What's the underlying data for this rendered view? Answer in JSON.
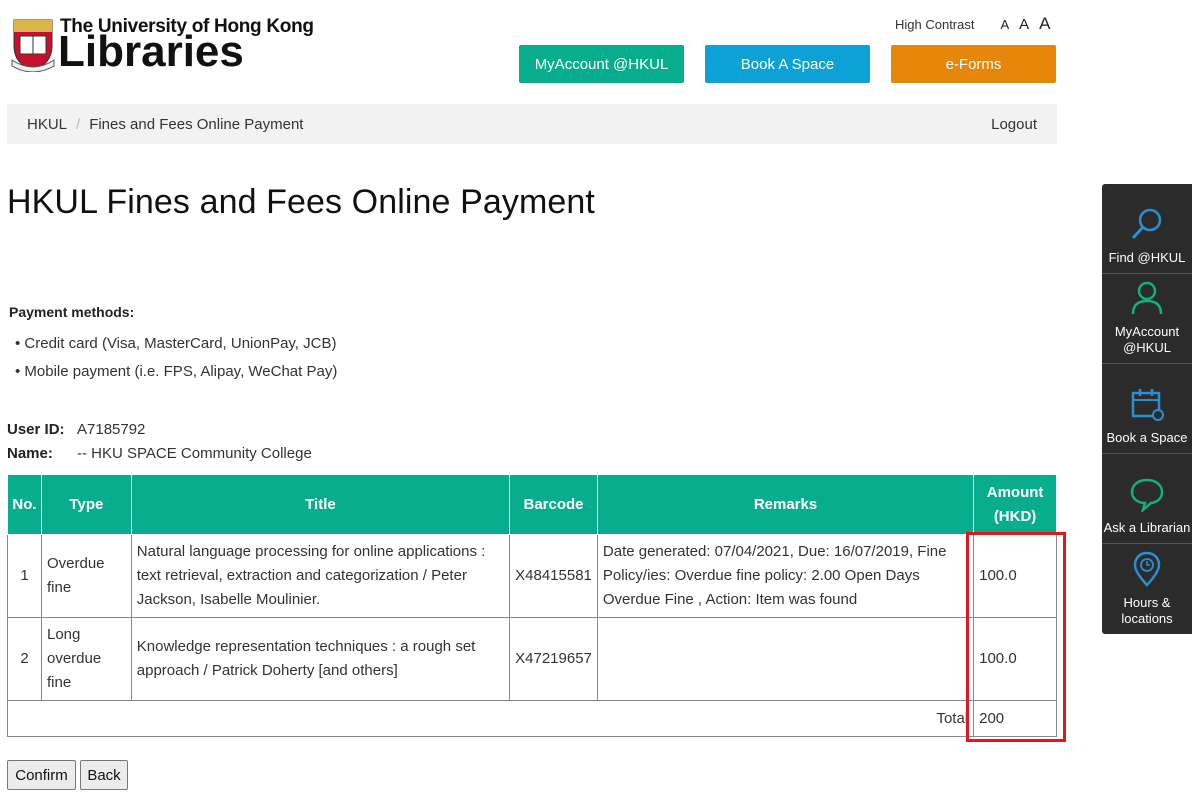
{
  "header": {
    "logo_line1": "The University of Hong Kong",
    "logo_line2": "Libraries",
    "high_contrast": "High Contrast",
    "font_sizes": [
      "A",
      "A",
      "A"
    ],
    "buttons": {
      "my_account": "MyAccount @HKUL",
      "book_space": "Book A Space",
      "eforms": "e-Forms"
    },
    "colors": {
      "my_account": "#07ad8c",
      "book_space": "#0ea1d6",
      "eforms": "#e5870a"
    }
  },
  "breadcrumb": {
    "home": "HKUL",
    "current": "Fines and Fees Online Payment",
    "logout": "Logout"
  },
  "page_title": "HKUL Fines and Fees Online Payment",
  "payment": {
    "title": "Payment methods:",
    "methods": [
      "• Credit card (Visa, MasterCard, UnionPay, JCB)",
      "• Mobile payment (i.e. FPS, Alipay, WeChat Pay)"
    ]
  },
  "user": {
    "id_label": "User ID:",
    "id_value": "A7185792",
    "name_label": "Name:",
    "name_value": "-- HKU SPACE Community College"
  },
  "table": {
    "headers": {
      "no": "No.",
      "type": "Type",
      "title": "Title",
      "barcode": "Barcode",
      "remarks": "Remarks",
      "amount_1": "Amount",
      "amount_2": "(HKD)"
    },
    "rows": [
      {
        "no": "1",
        "type": "Overdue fine",
        "title": "Natural language processing for online applications : text retrieval, extraction and categorization / Peter Jackson, Isabelle Moulinier.",
        "barcode": "X48415581",
        "remarks": "Date generated: 07/04/2021, Due: 16/07/2019, Fine Policy/ies: Overdue fine policy: 2.00 Open Days Overdue Fine , Action: Item was found",
        "amount": "100.0"
      },
      {
        "no": "2",
        "type": "Long overdue fine",
        "title": "Knowledge representation techniques : a rough set approach / Patrick Doherty [and others]",
        "barcode": "X47219657",
        "remarks": "",
        "amount": "100.0"
      }
    ],
    "total_label": "Total",
    "total_value": "200"
  },
  "actions": {
    "confirm": "Confirm",
    "back": "Back"
  },
  "side_panel": [
    {
      "label": "Find @HKUL",
      "icon": "search-icon"
    },
    {
      "label": "MyAccount @HKUL",
      "icon": "user-icon"
    },
    {
      "label": "Book a Space",
      "icon": "calendar-icon"
    },
    {
      "label": "Ask a Librarian",
      "icon": "chat-icon"
    },
    {
      "label": "Hours & locations",
      "icon": "location-pin-icon"
    }
  ],
  "highlight_color": "#e3161f"
}
